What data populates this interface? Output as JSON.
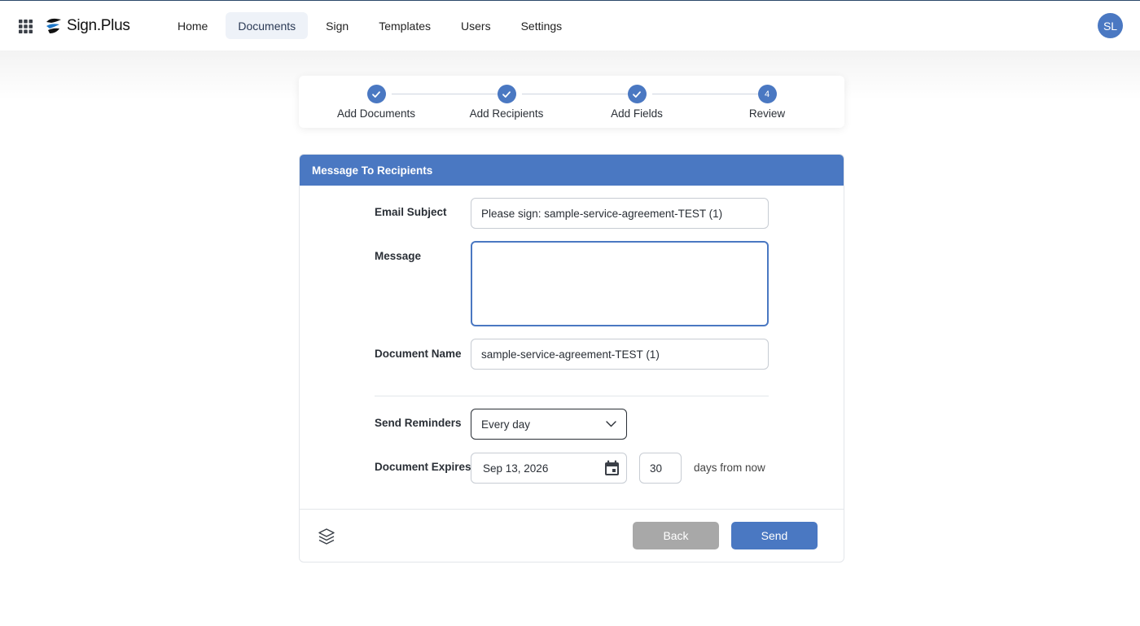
{
  "header": {
    "brand": "Sign.Plus",
    "nav": [
      {
        "label": "Home",
        "active": false
      },
      {
        "label": "Documents",
        "active": true
      },
      {
        "label": "Sign",
        "active": false
      },
      {
        "label": "Templates",
        "active": false
      },
      {
        "label": "Users",
        "active": false
      },
      {
        "label": "Settings",
        "active": false
      }
    ],
    "avatar_initials": "SL"
  },
  "stepper": {
    "steps": [
      {
        "label": "Add Documents",
        "state": "done"
      },
      {
        "label": "Add Recipients",
        "state": "done"
      },
      {
        "label": "Add Fields",
        "state": "done"
      },
      {
        "label": "Review",
        "state": "current",
        "number": "4"
      }
    ]
  },
  "form": {
    "title": "Message To Recipients",
    "email_subject_label": "Email Subject",
    "email_subject_value": "Please sign: sample-service-agreement-TEST (1)",
    "message_label": "Message",
    "message_value": "",
    "document_name_label": "Document Name",
    "document_name_value": "sample-service-agreement-TEST (1)",
    "reminders_label": "Send Reminders",
    "reminders_value": "Every day",
    "expires_label": "Document Expires",
    "expires_date": "Sep 13, 2026",
    "expires_days": "30",
    "expires_suffix": "days from now"
  },
  "footer": {
    "back_label": "Back",
    "send_label": "Send"
  },
  "colors": {
    "accent": "#4a78c2",
    "back_button": "#a8a8a8"
  },
  "icons": [
    "apps-grid-icon",
    "sign-plus-logo-icon",
    "check-icon",
    "calendar-icon",
    "chevron-down-icon",
    "layers-icon"
  ]
}
